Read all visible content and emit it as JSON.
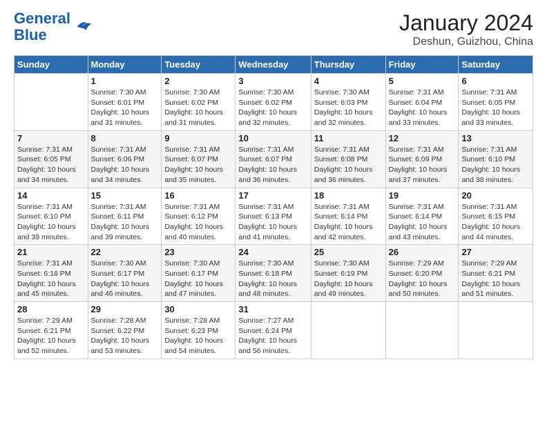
{
  "header": {
    "logo_line1": "General",
    "logo_line2": "Blue",
    "title": "January 2024",
    "subtitle": "Deshun, Guizhou, China"
  },
  "days_of_week": [
    "Sunday",
    "Monday",
    "Tuesday",
    "Wednesday",
    "Thursday",
    "Friday",
    "Saturday"
  ],
  "weeks": [
    [
      {
        "day": "",
        "sunrise": "",
        "sunset": "",
        "daylight": ""
      },
      {
        "day": "1",
        "sunrise": "Sunrise: 7:30 AM",
        "sunset": "Sunset: 6:01 PM",
        "daylight": "Daylight: 10 hours and 31 minutes."
      },
      {
        "day": "2",
        "sunrise": "Sunrise: 7:30 AM",
        "sunset": "Sunset: 6:02 PM",
        "daylight": "Daylight: 10 hours and 31 minutes."
      },
      {
        "day": "3",
        "sunrise": "Sunrise: 7:30 AM",
        "sunset": "Sunset: 6:02 PM",
        "daylight": "Daylight: 10 hours and 32 minutes."
      },
      {
        "day": "4",
        "sunrise": "Sunrise: 7:30 AM",
        "sunset": "Sunset: 6:03 PM",
        "daylight": "Daylight: 10 hours and 32 minutes."
      },
      {
        "day": "5",
        "sunrise": "Sunrise: 7:31 AM",
        "sunset": "Sunset: 6:04 PM",
        "daylight": "Daylight: 10 hours and 33 minutes."
      },
      {
        "day": "6",
        "sunrise": "Sunrise: 7:31 AM",
        "sunset": "Sunset: 6:05 PM",
        "daylight": "Daylight: 10 hours and 33 minutes."
      }
    ],
    [
      {
        "day": "7",
        "sunrise": "Sunrise: 7:31 AM",
        "sunset": "Sunset: 6:05 PM",
        "daylight": "Daylight: 10 hours and 34 minutes."
      },
      {
        "day": "8",
        "sunrise": "Sunrise: 7:31 AM",
        "sunset": "Sunset: 6:06 PM",
        "daylight": "Daylight: 10 hours and 34 minutes."
      },
      {
        "day": "9",
        "sunrise": "Sunrise: 7:31 AM",
        "sunset": "Sunset: 6:07 PM",
        "daylight": "Daylight: 10 hours and 35 minutes."
      },
      {
        "day": "10",
        "sunrise": "Sunrise: 7:31 AM",
        "sunset": "Sunset: 6:07 PM",
        "daylight": "Daylight: 10 hours and 36 minutes."
      },
      {
        "day": "11",
        "sunrise": "Sunrise: 7:31 AM",
        "sunset": "Sunset: 6:08 PM",
        "daylight": "Daylight: 10 hours and 36 minutes."
      },
      {
        "day": "12",
        "sunrise": "Sunrise: 7:31 AM",
        "sunset": "Sunset: 6:09 PM",
        "daylight": "Daylight: 10 hours and 37 minutes."
      },
      {
        "day": "13",
        "sunrise": "Sunrise: 7:31 AM",
        "sunset": "Sunset: 6:10 PM",
        "daylight": "Daylight: 10 hours and 38 minutes."
      }
    ],
    [
      {
        "day": "14",
        "sunrise": "Sunrise: 7:31 AM",
        "sunset": "Sunset: 6:10 PM",
        "daylight": "Daylight: 10 hours and 39 minutes."
      },
      {
        "day": "15",
        "sunrise": "Sunrise: 7:31 AM",
        "sunset": "Sunset: 6:11 PM",
        "daylight": "Daylight: 10 hours and 39 minutes."
      },
      {
        "day": "16",
        "sunrise": "Sunrise: 7:31 AM",
        "sunset": "Sunset: 6:12 PM",
        "daylight": "Daylight: 10 hours and 40 minutes."
      },
      {
        "day": "17",
        "sunrise": "Sunrise: 7:31 AM",
        "sunset": "Sunset: 6:13 PM",
        "daylight": "Daylight: 10 hours and 41 minutes."
      },
      {
        "day": "18",
        "sunrise": "Sunrise: 7:31 AM",
        "sunset": "Sunset: 6:14 PM",
        "daylight": "Daylight: 10 hours and 42 minutes."
      },
      {
        "day": "19",
        "sunrise": "Sunrise: 7:31 AM",
        "sunset": "Sunset: 6:14 PM",
        "daylight": "Daylight: 10 hours and 43 minutes."
      },
      {
        "day": "20",
        "sunrise": "Sunrise: 7:31 AM",
        "sunset": "Sunset: 6:15 PM",
        "daylight": "Daylight: 10 hours and 44 minutes."
      }
    ],
    [
      {
        "day": "21",
        "sunrise": "Sunrise: 7:31 AM",
        "sunset": "Sunset: 6:16 PM",
        "daylight": "Daylight: 10 hours and 45 minutes."
      },
      {
        "day": "22",
        "sunrise": "Sunrise: 7:30 AM",
        "sunset": "Sunset: 6:17 PM",
        "daylight": "Daylight: 10 hours and 46 minutes."
      },
      {
        "day": "23",
        "sunrise": "Sunrise: 7:30 AM",
        "sunset": "Sunset: 6:17 PM",
        "daylight": "Daylight: 10 hours and 47 minutes."
      },
      {
        "day": "24",
        "sunrise": "Sunrise: 7:30 AM",
        "sunset": "Sunset: 6:18 PM",
        "daylight": "Daylight: 10 hours and 48 minutes."
      },
      {
        "day": "25",
        "sunrise": "Sunrise: 7:30 AM",
        "sunset": "Sunset: 6:19 PM",
        "daylight": "Daylight: 10 hours and 49 minutes."
      },
      {
        "day": "26",
        "sunrise": "Sunrise: 7:29 AM",
        "sunset": "Sunset: 6:20 PM",
        "daylight": "Daylight: 10 hours and 50 minutes."
      },
      {
        "day": "27",
        "sunrise": "Sunrise: 7:29 AM",
        "sunset": "Sunset: 6:21 PM",
        "daylight": "Daylight: 10 hours and 51 minutes."
      }
    ],
    [
      {
        "day": "28",
        "sunrise": "Sunrise: 7:29 AM",
        "sunset": "Sunset: 6:21 PM",
        "daylight": "Daylight: 10 hours and 52 minutes."
      },
      {
        "day": "29",
        "sunrise": "Sunrise: 7:28 AM",
        "sunset": "Sunset: 6:22 PM",
        "daylight": "Daylight: 10 hours and 53 minutes."
      },
      {
        "day": "30",
        "sunrise": "Sunrise: 7:28 AM",
        "sunset": "Sunset: 6:23 PM",
        "daylight": "Daylight: 10 hours and 54 minutes."
      },
      {
        "day": "31",
        "sunrise": "Sunrise: 7:27 AM",
        "sunset": "Sunset: 6:24 PM",
        "daylight": "Daylight: 10 hours and 56 minutes."
      },
      {
        "day": "",
        "sunrise": "",
        "sunset": "",
        "daylight": ""
      },
      {
        "day": "",
        "sunrise": "",
        "sunset": "",
        "daylight": ""
      },
      {
        "day": "",
        "sunrise": "",
        "sunset": "",
        "daylight": ""
      }
    ]
  ]
}
